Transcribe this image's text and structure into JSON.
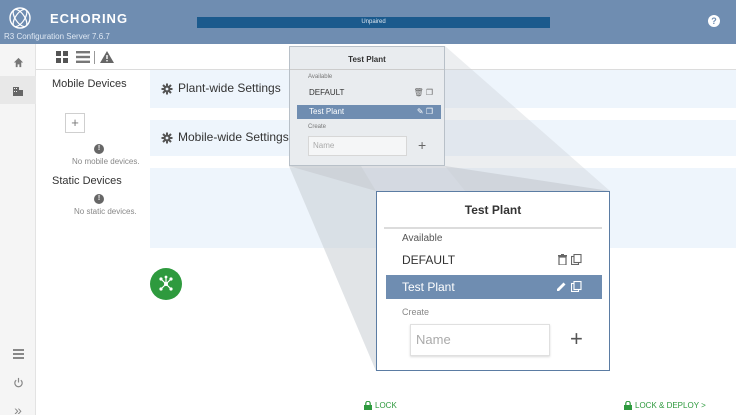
{
  "header": {
    "brand": "ECHORING",
    "subtitle": "R3 Configuration Server 7.6.7",
    "status": "Unpaired",
    "help_icon": "help-icon"
  },
  "colors": {
    "header_bg": "#6f8db1",
    "status_bar": "#1b5a8d",
    "selected_row": "#6f8db1",
    "panel_bg": "#eef5fc",
    "fab": "#2e9a3e",
    "footer_link": "#2e9a3e"
  },
  "rail": {
    "items": [
      {
        "icon": "home-icon"
      },
      {
        "icon": "devices-icon"
      },
      {
        "icon": "list-icon"
      },
      {
        "icon": "power-icon"
      },
      {
        "icon": "expand-icon"
      }
    ]
  },
  "toolbar": {
    "icons": [
      "grid-icon",
      "list-icon",
      "warning-icon"
    ]
  },
  "devices": {
    "mobile_title": "Mobile Devices",
    "add_symbol": "+",
    "no_mobile": "No mobile devices.",
    "static_title": "Static Devices",
    "no_static": "No static devices."
  },
  "panels": {
    "plant_wide": "Plant-wide Settings",
    "mobile_wide": "Mobile-wide Settings"
  },
  "popup": {
    "title": "Test Plant",
    "available_label": "Available",
    "plants": [
      {
        "name": "DEFAULT",
        "selected": false
      },
      {
        "name": "Test Plant",
        "selected": true
      }
    ],
    "create_label": "Create",
    "name_placeholder": "Name",
    "add_symbol": "+"
  },
  "footer": {
    "lock": "LOCK",
    "lock_deploy": "LOCK & DEPLOY >"
  }
}
